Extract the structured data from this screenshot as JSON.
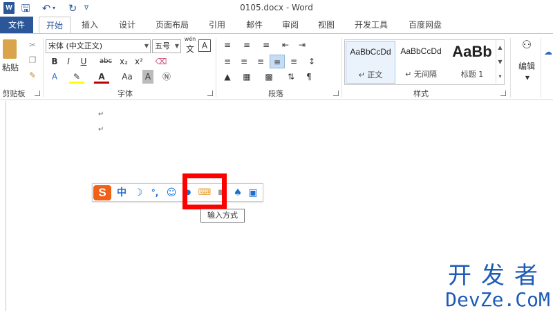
{
  "app": {
    "window_title": "0105.docx - Word",
    "logo_letter": "W"
  },
  "quick_access": {
    "save_icon": "save-icon",
    "undo_icon": "undo-icon",
    "redo_icon": "redo-icon",
    "customize_icon": "customize-qat-icon"
  },
  "tabs": [
    {
      "label": "文件"
    },
    {
      "label": "开始"
    },
    {
      "label": "插入"
    },
    {
      "label": "设计"
    },
    {
      "label": "页面布局"
    },
    {
      "label": "引用"
    },
    {
      "label": "邮件"
    },
    {
      "label": "审阅"
    },
    {
      "label": "视图"
    },
    {
      "label": "开发工具"
    },
    {
      "label": "百度网盘"
    }
  ],
  "ribbon": {
    "clipboard": {
      "paste_label": "粘贴",
      "group_label": "剪贴板"
    },
    "font": {
      "font_name": "宋体 (中文正文)",
      "font_size": "五号",
      "group_label": "字体",
      "phonetic_label": "wén",
      "border_char": "A"
    },
    "paragraph": {
      "group_label": "段落"
    },
    "styles": {
      "group_label": "样式",
      "items": [
        {
          "sample": "AaBbCcDd",
          "name": "↵ 正文"
        },
        {
          "sample": "AaBbCcDd",
          "name": "↵ 无间隔"
        },
        {
          "sample": "AaBb",
          "name": "标题 1"
        }
      ]
    },
    "editing": {
      "label": "编辑"
    }
  },
  "document": {
    "para_mark": "↵"
  },
  "ime": {
    "logo": "S",
    "buttons": [
      "中",
      "☽",
      "°,",
      "☺",
      "⌨",
      "♟",
      "▣"
    ],
    "tooltip": "输入方式",
    "highlight_color": "#ff0000",
    "brand_color": "#f06017"
  },
  "watermark": {
    "cn": "开发者",
    "en": "DevZe.CoM"
  },
  "colors": {
    "accent": "#2b579a",
    "watermark": "#1e5bb8"
  }
}
